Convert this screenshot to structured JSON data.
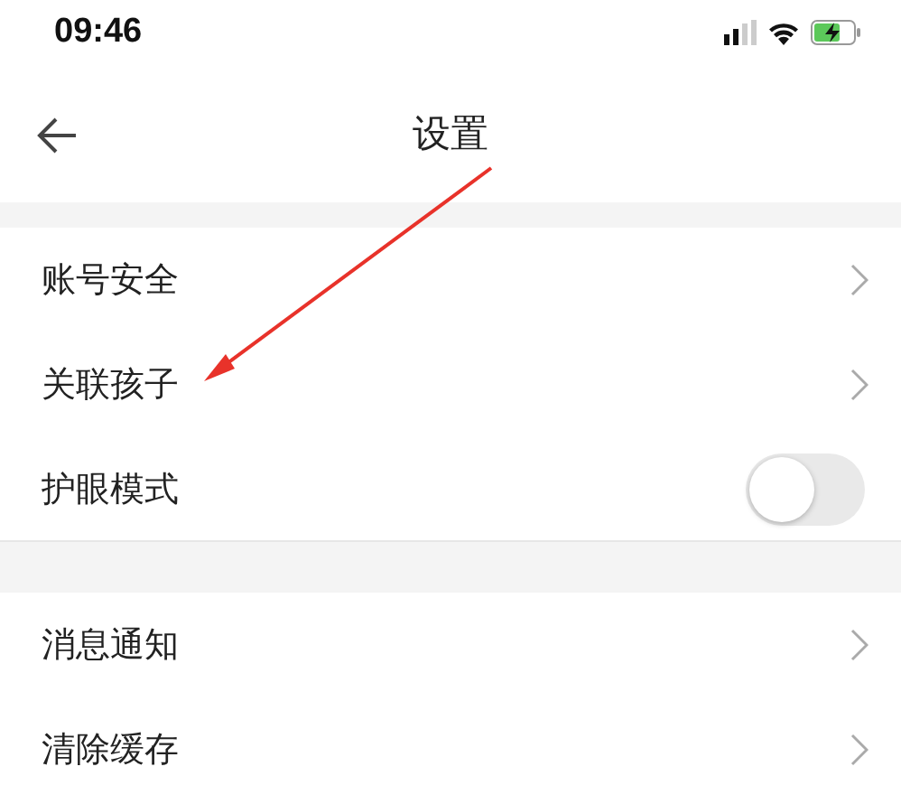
{
  "status_bar": {
    "time": "09:46"
  },
  "header": {
    "title": "设置"
  },
  "sections": [
    {
      "items": [
        {
          "label": "账号安全",
          "kind": "link"
        },
        {
          "label": "关联孩子",
          "kind": "link"
        },
        {
          "label": "护眼模式",
          "kind": "toggle",
          "on": false
        }
      ]
    },
    {
      "items": [
        {
          "label": "消息通知",
          "kind": "link"
        },
        {
          "label": "清除缓存",
          "kind": "link"
        }
      ]
    }
  ]
}
